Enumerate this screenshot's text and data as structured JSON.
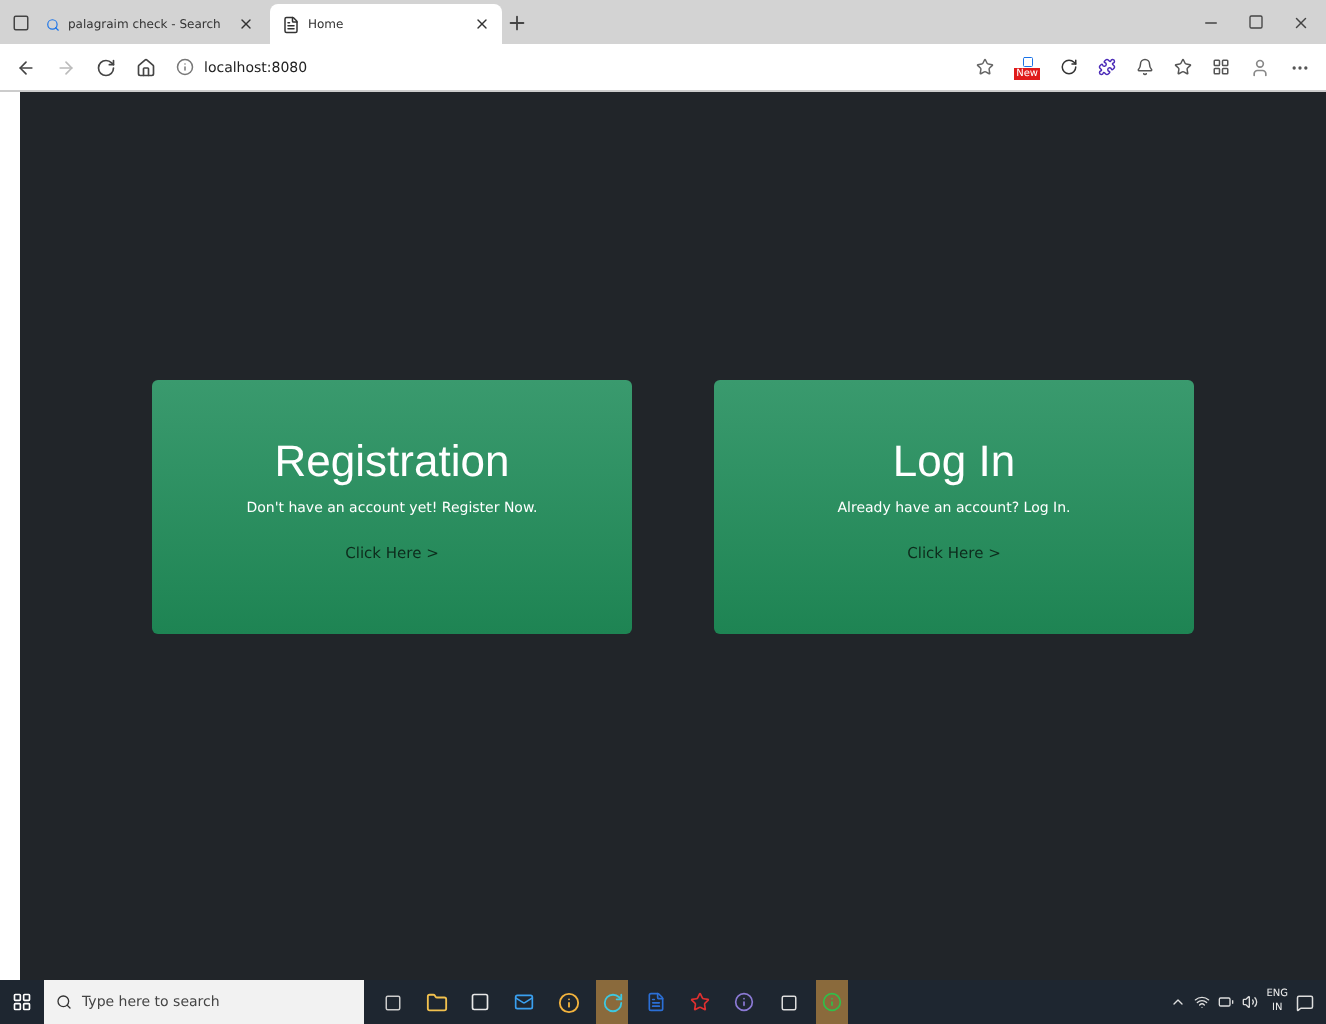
{
  "browser": {
    "tabs": [
      {
        "title": "palagraim check - Search",
        "kind": "search",
        "selected": false
      },
      {
        "title": "Home",
        "kind": "page",
        "selected": true
      }
    ],
    "address": "localhost:8080",
    "extension_badge": "New"
  },
  "cards": [
    {
      "title": "Registration",
      "text": "Don't have an account yet! Register Now.",
      "link": "Click Here >"
    },
    {
      "title": "Log In",
      "text": "Already have an account? Log In.",
      "link": "Click Here >"
    }
  ],
  "taskbar": {
    "search_placeholder": "Type here to search",
    "language": "ENG",
    "region": "IN"
  }
}
